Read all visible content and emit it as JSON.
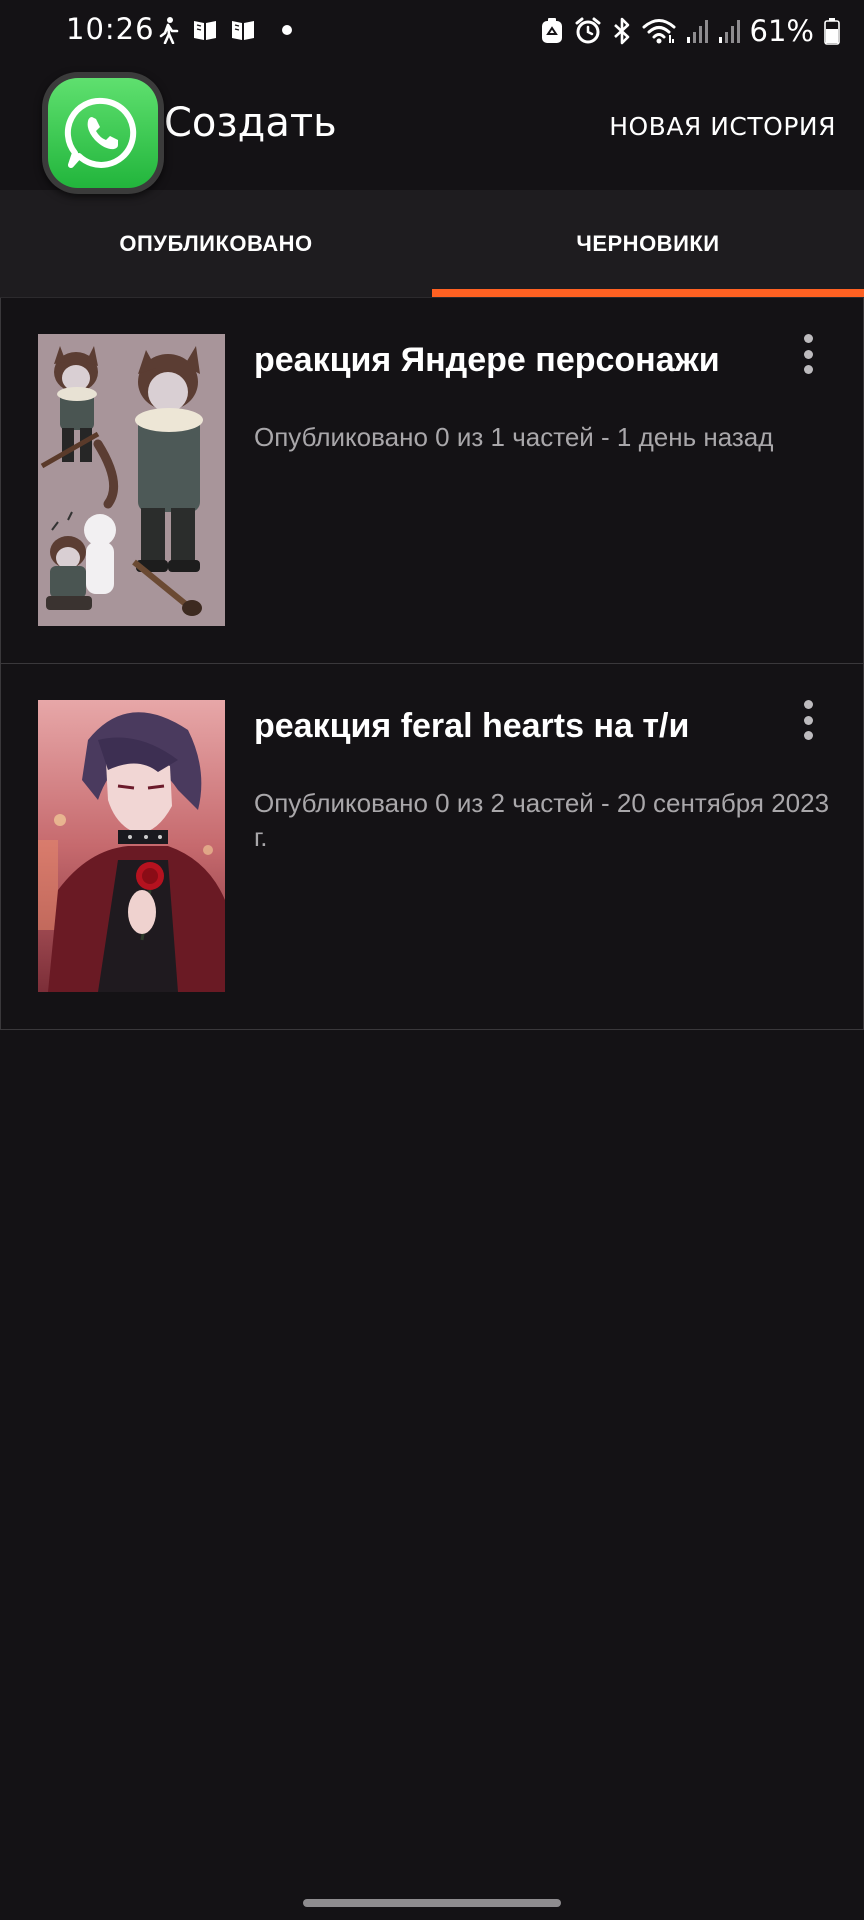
{
  "status_bar": {
    "time": "10:26",
    "battery_percent": "61%",
    "left_icons": [
      "walking-icon",
      "book-icon",
      "book-icon",
      "dot-icon"
    ],
    "right_icons": [
      "recycle-icon",
      "alarm-icon",
      "bluetooth-icon",
      "wifi-icon",
      "signal-icon",
      "signal-icon",
      "battery-icon"
    ]
  },
  "app_bar": {
    "title": "Создать",
    "new_story_label": "НОВАЯ ИСТОРИЯ",
    "overlay_icon": "whatsapp-icon"
  },
  "tabs": [
    {
      "label": "ОПУБЛИКОВАНО",
      "active": false
    },
    {
      "label": "ЧЕРНОВИКИ",
      "active": true
    }
  ],
  "stories": [
    {
      "title": "реакция Яндере персонажи",
      "meta": "Опубликовано 0 из 1 частей - 1 день назад"
    },
    {
      "title": "реакция feral hearts на т/и",
      "meta": "Опубликовано 0 из 2 частей - 20 сентября 2023 г."
    }
  ],
  "colors": {
    "background": "#141215",
    "tab_bar": "#1e1c1f",
    "accent": "#ff6122",
    "secondary_text": "#a9a7aa"
  }
}
